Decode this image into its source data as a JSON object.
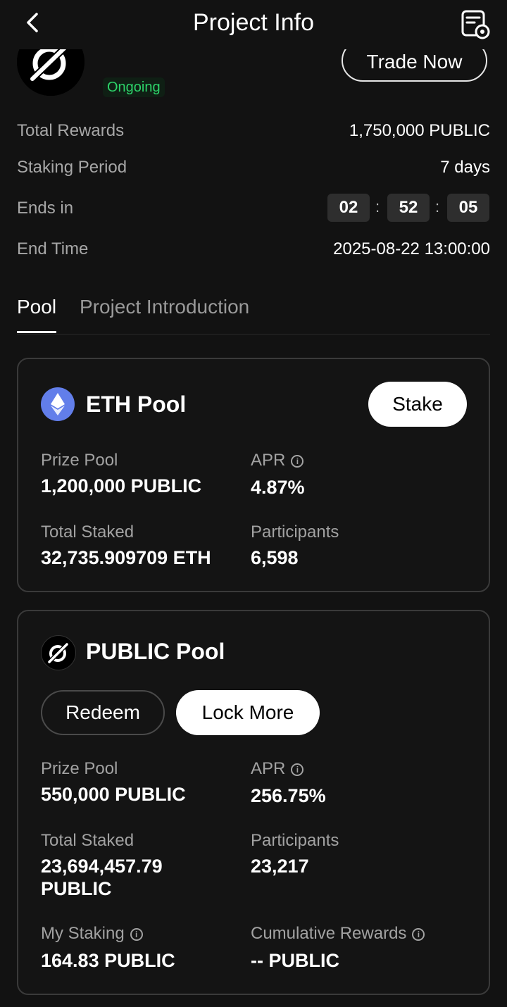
{
  "header": {
    "title": "Project Info"
  },
  "project": {
    "status": "Ongoing",
    "trade_label": "Trade Now"
  },
  "details": {
    "total_rewards_label": "Total Rewards",
    "total_rewards_value": "1,750,000 PUBLIC",
    "staking_period_label": "Staking Period",
    "staking_period_value": "7 days",
    "ends_in_label": "Ends in",
    "ends_hours": "02",
    "ends_minutes": "52",
    "ends_seconds": "05",
    "end_time_label": "End Time",
    "end_time_value": "2025-08-22 13:00:00"
  },
  "tabs": [
    {
      "label": "Pool",
      "active": true
    },
    {
      "label": "Project Introduction",
      "active": false
    }
  ],
  "eth_pool": {
    "title": "ETH Pool",
    "stake_label": "Stake",
    "prize_pool_label": "Prize Pool",
    "prize_pool_value": "1,200,000 PUBLIC",
    "apr_label": "APR",
    "apr_value": "4.87%",
    "total_staked_label": "Total Staked",
    "total_staked_value": "32,735.909709 ETH",
    "participants_label": "Participants",
    "participants_value": "6,598"
  },
  "public_pool": {
    "title": "PUBLIC Pool",
    "redeem_label": "Redeem",
    "lock_more_label": "Lock More",
    "prize_pool_label": "Prize Pool",
    "prize_pool_value": "550,000 PUBLIC",
    "apr_label": "APR",
    "apr_value": "256.75%",
    "total_staked_label": "Total Staked",
    "total_staked_value_line1": "23,694,457.79",
    "total_staked_value_line2": "PUBLIC",
    "participants_label": "Participants",
    "participants_value": "23,217",
    "my_staking_label": "My Staking",
    "my_staking_value": "164.83 PUBLIC",
    "cumulative_rewards_label": "Cumulative Rewards",
    "cumulative_rewards_value": "-- PUBLIC"
  },
  "colors": {
    "background": "#121212",
    "status_green": "#2dd46a",
    "eth_blue": "#627eea"
  }
}
